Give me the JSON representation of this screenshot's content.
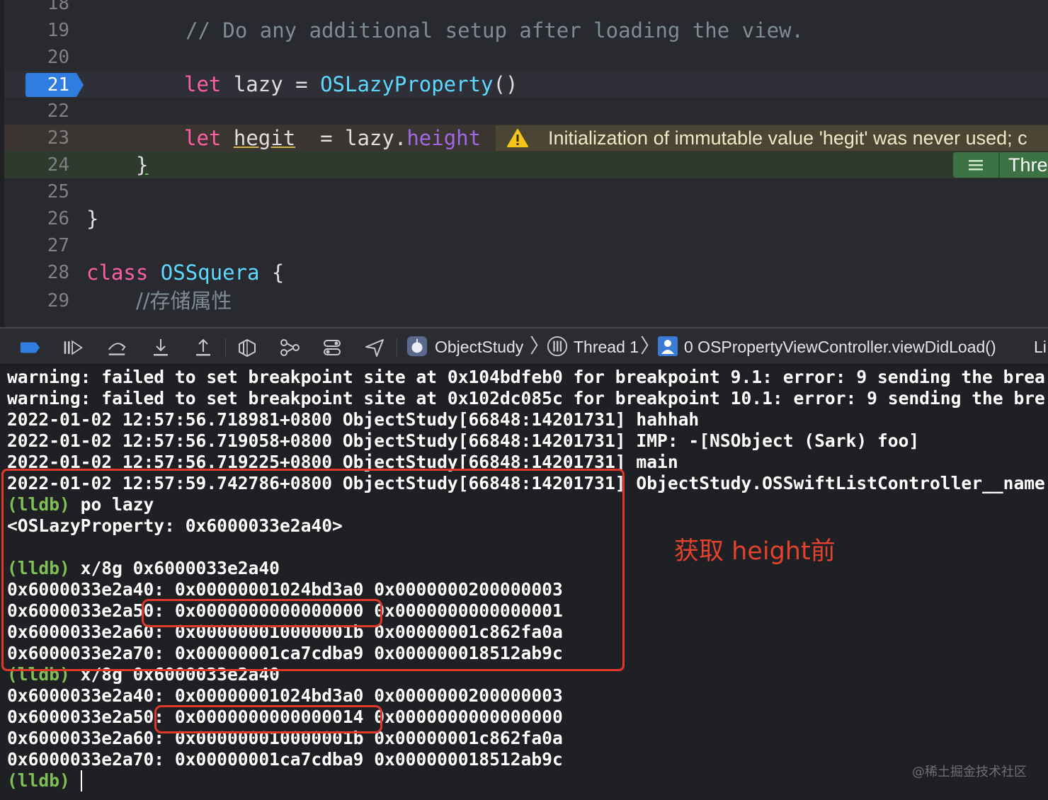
{
  "editor": {
    "lines": [
      {
        "num": "18"
      },
      {
        "num": "19",
        "comment": "// Do any additional setup after loading the view."
      },
      {
        "num": "20"
      },
      {
        "num": "21",
        "kw": "let",
        "ident": " lazy = ",
        "type": "OSLazyProperty",
        "rest": "()"
      },
      {
        "num": "22"
      },
      {
        "num": "23",
        "kw": "let",
        "ident_pre": " ",
        "ident_var": "hegit",
        "ident_mid": "  = lazy.",
        "prop": "height"
      },
      {
        "num": "24",
        "text": "}"
      },
      {
        "num": "25"
      },
      {
        "num": "26",
        "text": "}"
      },
      {
        "num": "27"
      },
      {
        "num": "28",
        "kw": "class",
        "type": "OSSquera",
        "rest": " {"
      },
      {
        "num": "29",
        "comment": "//存储属性"
      }
    ],
    "warning": "Initialization of immutable value 'hegit' was never used; c",
    "thread_marker": "Threa"
  },
  "debug_bar": {
    "app": "ObjectStudy",
    "thread": "Thread 1",
    "frame": "0 OSPropertyViewController.viewDidLoad()",
    "trailing": "Li"
  },
  "console": {
    "lines": [
      {
        "text": "warning: failed to set breakpoint site at 0x104bdfeb0 for breakpoint 9.1: error: 9 sending the brea"
      },
      {
        "text": "warning: failed to set breakpoint site at 0x102dc085c for breakpoint 10.1: error: 9 sending the bre"
      },
      {
        "text": "2022-01-02 12:57:56.718981+0800 ObjectStudy[66848:14201731] hahhah"
      },
      {
        "text": "2022-01-02 12:57:56.719058+0800 ObjectStudy[66848:14201731] IMP: -[NSObject (Sark) foo]"
      },
      {
        "text": "2022-01-02 12:57:56.719225+0800 ObjectStudy[66848:14201731] main"
      },
      {
        "text": "2022-01-02 12:57:59.742786+0800 ObjectStudy[66848:14201731] ObjectStudy.OSSwiftListController__name"
      },
      {
        "prompt": "(lldb)",
        "text": " po lazy"
      },
      {
        "text": "<OSLazyProperty: 0x6000033e2a40>"
      },
      {
        "text": ""
      },
      {
        "prompt": "(lldb)",
        "text": " x/8g 0x6000033e2a40"
      },
      {
        "text": "0x6000033e2a40: 0x00000001024bd3a0 0x0000000200000003"
      },
      {
        "text": "0x6000033e2a50: 0x0000000000000000 0x0000000000000001"
      },
      {
        "text": "0x6000033e2a60: 0x000000010000001b 0x00000001c862fa0a"
      },
      {
        "text": "0x6000033e2a70: 0x00000001ca7cdba9 0x000000018512ab9c"
      },
      {
        "prompt": "(lldb)",
        "text": " x/8g 0x6000033e2a40"
      },
      {
        "text": "0x6000033e2a40: 0x00000001024bd3a0 0x0000000200000003"
      },
      {
        "text": "0x6000033e2a50: 0x0000000000000014 0x0000000000000000"
      },
      {
        "text": "0x6000033e2a60: 0x000000010000001b 0x00000001c862fa0a"
      },
      {
        "text": "0x6000033e2a70: 0x00000001ca7cdba9 0x000000018512ab9c"
      },
      {
        "prompt": "(lldb)",
        "text": " "
      }
    ],
    "annotation": "获取 height前",
    "watermark": "@稀土掘金技术社区"
  },
  "colors": {
    "keyword": "#fc5fa3",
    "type": "#5dd8ff",
    "property": "#a167e6",
    "comment": "#7f8c98",
    "breakpoint": "#2f7de1",
    "warning_bg": "#4b4534",
    "thread_bg": "#3d7245",
    "lldb_prompt": "#7fbf55",
    "annotation": "#e4412f"
  }
}
